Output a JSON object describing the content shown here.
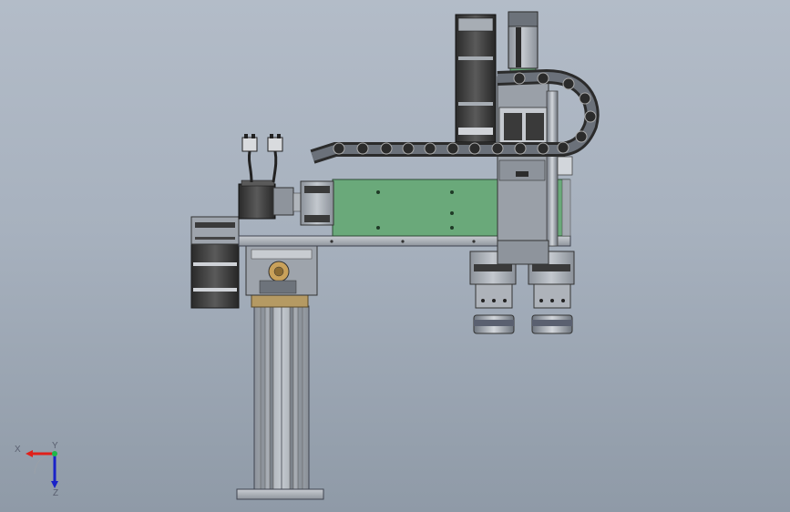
{
  "viewport": {
    "background_top": "#b3bcc8",
    "background_bottom": "#8f9aa7"
  },
  "model": {
    "plate_color": "#6aa97a",
    "frame_color": "#a4aab2",
    "motor_color": "#3a3a3a",
    "brass_color": "#b59a63"
  },
  "triad": {
    "x_label": "X",
    "y_label": "Y",
    "z_label": "Z",
    "x_color": "#e0201a",
    "y_color": "#1fb84a",
    "z_color": "#1a22c8"
  }
}
